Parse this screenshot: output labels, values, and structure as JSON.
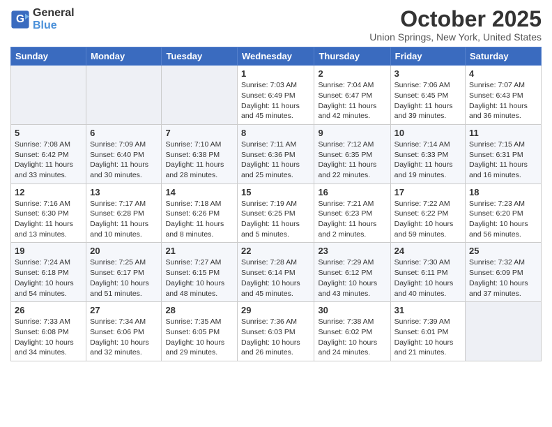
{
  "logo": {
    "line1": "General",
    "line2": "Blue"
  },
  "title": "October 2025",
  "location": "Union Springs, New York, United States",
  "weekdays": [
    "Sunday",
    "Monday",
    "Tuesday",
    "Wednesday",
    "Thursday",
    "Friday",
    "Saturday"
  ],
  "weeks": [
    [
      {
        "day": "",
        "info": ""
      },
      {
        "day": "",
        "info": ""
      },
      {
        "day": "",
        "info": ""
      },
      {
        "day": "1",
        "info": "Sunrise: 7:03 AM\nSunset: 6:49 PM\nDaylight: 11 hours\nand 45 minutes."
      },
      {
        "day": "2",
        "info": "Sunrise: 7:04 AM\nSunset: 6:47 PM\nDaylight: 11 hours\nand 42 minutes."
      },
      {
        "day": "3",
        "info": "Sunrise: 7:06 AM\nSunset: 6:45 PM\nDaylight: 11 hours\nand 39 minutes."
      },
      {
        "day": "4",
        "info": "Sunrise: 7:07 AM\nSunset: 6:43 PM\nDaylight: 11 hours\nand 36 minutes."
      }
    ],
    [
      {
        "day": "5",
        "info": "Sunrise: 7:08 AM\nSunset: 6:42 PM\nDaylight: 11 hours\nand 33 minutes."
      },
      {
        "day": "6",
        "info": "Sunrise: 7:09 AM\nSunset: 6:40 PM\nDaylight: 11 hours\nand 30 minutes."
      },
      {
        "day": "7",
        "info": "Sunrise: 7:10 AM\nSunset: 6:38 PM\nDaylight: 11 hours\nand 28 minutes."
      },
      {
        "day": "8",
        "info": "Sunrise: 7:11 AM\nSunset: 6:36 PM\nDaylight: 11 hours\nand 25 minutes."
      },
      {
        "day": "9",
        "info": "Sunrise: 7:12 AM\nSunset: 6:35 PM\nDaylight: 11 hours\nand 22 minutes."
      },
      {
        "day": "10",
        "info": "Sunrise: 7:14 AM\nSunset: 6:33 PM\nDaylight: 11 hours\nand 19 minutes."
      },
      {
        "day": "11",
        "info": "Sunrise: 7:15 AM\nSunset: 6:31 PM\nDaylight: 11 hours\nand 16 minutes."
      }
    ],
    [
      {
        "day": "12",
        "info": "Sunrise: 7:16 AM\nSunset: 6:30 PM\nDaylight: 11 hours\nand 13 minutes."
      },
      {
        "day": "13",
        "info": "Sunrise: 7:17 AM\nSunset: 6:28 PM\nDaylight: 11 hours\nand 10 minutes."
      },
      {
        "day": "14",
        "info": "Sunrise: 7:18 AM\nSunset: 6:26 PM\nDaylight: 11 hours\nand 8 minutes."
      },
      {
        "day": "15",
        "info": "Sunrise: 7:19 AM\nSunset: 6:25 PM\nDaylight: 11 hours\nand 5 minutes."
      },
      {
        "day": "16",
        "info": "Sunrise: 7:21 AM\nSunset: 6:23 PM\nDaylight: 11 hours\nand 2 minutes."
      },
      {
        "day": "17",
        "info": "Sunrise: 7:22 AM\nSunset: 6:22 PM\nDaylight: 10 hours\nand 59 minutes."
      },
      {
        "day": "18",
        "info": "Sunrise: 7:23 AM\nSunset: 6:20 PM\nDaylight: 10 hours\nand 56 minutes."
      }
    ],
    [
      {
        "day": "19",
        "info": "Sunrise: 7:24 AM\nSunset: 6:18 PM\nDaylight: 10 hours\nand 54 minutes."
      },
      {
        "day": "20",
        "info": "Sunrise: 7:25 AM\nSunset: 6:17 PM\nDaylight: 10 hours\nand 51 minutes."
      },
      {
        "day": "21",
        "info": "Sunrise: 7:27 AM\nSunset: 6:15 PM\nDaylight: 10 hours\nand 48 minutes."
      },
      {
        "day": "22",
        "info": "Sunrise: 7:28 AM\nSunset: 6:14 PM\nDaylight: 10 hours\nand 45 minutes."
      },
      {
        "day": "23",
        "info": "Sunrise: 7:29 AM\nSunset: 6:12 PM\nDaylight: 10 hours\nand 43 minutes."
      },
      {
        "day": "24",
        "info": "Sunrise: 7:30 AM\nSunset: 6:11 PM\nDaylight: 10 hours\nand 40 minutes."
      },
      {
        "day": "25",
        "info": "Sunrise: 7:32 AM\nSunset: 6:09 PM\nDaylight: 10 hours\nand 37 minutes."
      }
    ],
    [
      {
        "day": "26",
        "info": "Sunrise: 7:33 AM\nSunset: 6:08 PM\nDaylight: 10 hours\nand 34 minutes."
      },
      {
        "day": "27",
        "info": "Sunrise: 7:34 AM\nSunset: 6:06 PM\nDaylight: 10 hours\nand 32 minutes."
      },
      {
        "day": "28",
        "info": "Sunrise: 7:35 AM\nSunset: 6:05 PM\nDaylight: 10 hours\nand 29 minutes."
      },
      {
        "day": "29",
        "info": "Sunrise: 7:36 AM\nSunset: 6:03 PM\nDaylight: 10 hours\nand 26 minutes."
      },
      {
        "day": "30",
        "info": "Sunrise: 7:38 AM\nSunset: 6:02 PM\nDaylight: 10 hours\nand 24 minutes."
      },
      {
        "day": "31",
        "info": "Sunrise: 7:39 AM\nSunset: 6:01 PM\nDaylight: 10 hours\nand 21 minutes."
      },
      {
        "day": "",
        "info": ""
      }
    ]
  ]
}
